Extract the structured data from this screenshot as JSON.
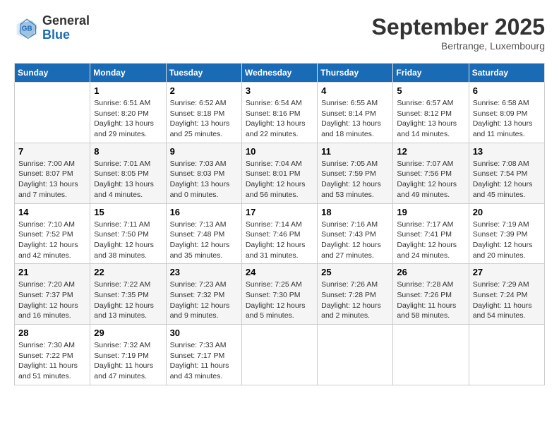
{
  "header": {
    "logo_general": "General",
    "logo_blue": "Blue",
    "month_title": "September 2025",
    "subtitle": "Bertrange, Luxembourg"
  },
  "weekdays": [
    "Sunday",
    "Monday",
    "Tuesday",
    "Wednesday",
    "Thursday",
    "Friday",
    "Saturday"
  ],
  "weeks": [
    [
      {
        "day": "",
        "info": ""
      },
      {
        "day": "1",
        "info": "Sunrise: 6:51 AM\nSunset: 8:20 PM\nDaylight: 13 hours\nand 29 minutes."
      },
      {
        "day": "2",
        "info": "Sunrise: 6:52 AM\nSunset: 8:18 PM\nDaylight: 13 hours\nand 25 minutes."
      },
      {
        "day": "3",
        "info": "Sunrise: 6:54 AM\nSunset: 8:16 PM\nDaylight: 13 hours\nand 22 minutes."
      },
      {
        "day": "4",
        "info": "Sunrise: 6:55 AM\nSunset: 8:14 PM\nDaylight: 13 hours\nand 18 minutes."
      },
      {
        "day": "5",
        "info": "Sunrise: 6:57 AM\nSunset: 8:12 PM\nDaylight: 13 hours\nand 14 minutes."
      },
      {
        "day": "6",
        "info": "Sunrise: 6:58 AM\nSunset: 8:09 PM\nDaylight: 13 hours\nand 11 minutes."
      }
    ],
    [
      {
        "day": "7",
        "info": "Sunrise: 7:00 AM\nSunset: 8:07 PM\nDaylight: 13 hours\nand 7 minutes."
      },
      {
        "day": "8",
        "info": "Sunrise: 7:01 AM\nSunset: 8:05 PM\nDaylight: 13 hours\nand 4 minutes."
      },
      {
        "day": "9",
        "info": "Sunrise: 7:03 AM\nSunset: 8:03 PM\nDaylight: 13 hours\nand 0 minutes."
      },
      {
        "day": "10",
        "info": "Sunrise: 7:04 AM\nSunset: 8:01 PM\nDaylight: 12 hours\nand 56 minutes."
      },
      {
        "day": "11",
        "info": "Sunrise: 7:05 AM\nSunset: 7:59 PM\nDaylight: 12 hours\nand 53 minutes."
      },
      {
        "day": "12",
        "info": "Sunrise: 7:07 AM\nSunset: 7:56 PM\nDaylight: 12 hours\nand 49 minutes."
      },
      {
        "day": "13",
        "info": "Sunrise: 7:08 AM\nSunset: 7:54 PM\nDaylight: 12 hours\nand 45 minutes."
      }
    ],
    [
      {
        "day": "14",
        "info": "Sunrise: 7:10 AM\nSunset: 7:52 PM\nDaylight: 12 hours\nand 42 minutes."
      },
      {
        "day": "15",
        "info": "Sunrise: 7:11 AM\nSunset: 7:50 PM\nDaylight: 12 hours\nand 38 minutes."
      },
      {
        "day": "16",
        "info": "Sunrise: 7:13 AM\nSunset: 7:48 PM\nDaylight: 12 hours\nand 35 minutes."
      },
      {
        "day": "17",
        "info": "Sunrise: 7:14 AM\nSunset: 7:46 PM\nDaylight: 12 hours\nand 31 minutes."
      },
      {
        "day": "18",
        "info": "Sunrise: 7:16 AM\nSunset: 7:43 PM\nDaylight: 12 hours\nand 27 minutes."
      },
      {
        "day": "19",
        "info": "Sunrise: 7:17 AM\nSunset: 7:41 PM\nDaylight: 12 hours\nand 24 minutes."
      },
      {
        "day": "20",
        "info": "Sunrise: 7:19 AM\nSunset: 7:39 PM\nDaylight: 12 hours\nand 20 minutes."
      }
    ],
    [
      {
        "day": "21",
        "info": "Sunrise: 7:20 AM\nSunset: 7:37 PM\nDaylight: 12 hours\nand 16 minutes."
      },
      {
        "day": "22",
        "info": "Sunrise: 7:22 AM\nSunset: 7:35 PM\nDaylight: 12 hours\nand 13 minutes."
      },
      {
        "day": "23",
        "info": "Sunrise: 7:23 AM\nSunset: 7:32 PM\nDaylight: 12 hours\nand 9 minutes."
      },
      {
        "day": "24",
        "info": "Sunrise: 7:25 AM\nSunset: 7:30 PM\nDaylight: 12 hours\nand 5 minutes."
      },
      {
        "day": "25",
        "info": "Sunrise: 7:26 AM\nSunset: 7:28 PM\nDaylight: 12 hours\nand 2 minutes."
      },
      {
        "day": "26",
        "info": "Sunrise: 7:28 AM\nSunset: 7:26 PM\nDaylight: 11 hours\nand 58 minutes."
      },
      {
        "day": "27",
        "info": "Sunrise: 7:29 AM\nSunset: 7:24 PM\nDaylight: 11 hours\nand 54 minutes."
      }
    ],
    [
      {
        "day": "28",
        "info": "Sunrise: 7:30 AM\nSunset: 7:22 PM\nDaylight: 11 hours\nand 51 minutes."
      },
      {
        "day": "29",
        "info": "Sunrise: 7:32 AM\nSunset: 7:19 PM\nDaylight: 11 hours\nand 47 minutes."
      },
      {
        "day": "30",
        "info": "Sunrise: 7:33 AM\nSunset: 7:17 PM\nDaylight: 11 hours\nand 43 minutes."
      },
      {
        "day": "",
        "info": ""
      },
      {
        "day": "",
        "info": ""
      },
      {
        "day": "",
        "info": ""
      },
      {
        "day": "",
        "info": ""
      }
    ]
  ]
}
